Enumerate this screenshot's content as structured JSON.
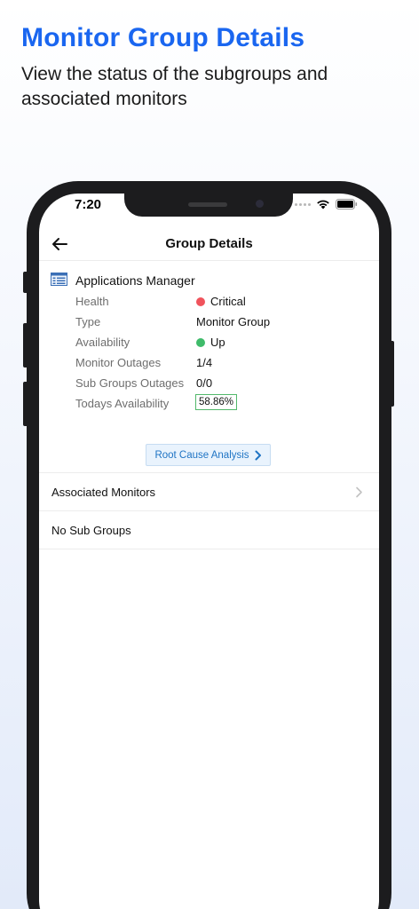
{
  "promo": {
    "title": "Monitor Group Details",
    "subtitle": "View the status of the subgroups and associated monitors"
  },
  "status_bar": {
    "time": "7:20"
  },
  "nav": {
    "title": "Group Details",
    "back_icon": "arrow-left-icon"
  },
  "group": {
    "name": "Applications Manager",
    "icon": "table-list-icon",
    "rows": [
      {
        "label": "Health",
        "value": "Critical",
        "status_color": "#f0535c"
      },
      {
        "label": "Type",
        "value": "Monitor Group"
      },
      {
        "label": "Availability",
        "value": "Up",
        "status_color": "#3fbb6a"
      },
      {
        "label": "Monitor Outages",
        "value": "1/4"
      },
      {
        "label": "Sub Groups Outages",
        "value": "0/0"
      },
      {
        "label": "Todays Availability",
        "value": "58.86%",
        "badge_color": "#52b86b"
      }
    ],
    "rca_button": "Root Cause Analysis"
  },
  "list": [
    {
      "label": "Associated Monitors",
      "has_chevron": true
    },
    {
      "label": "No Sub Groups",
      "has_chevron": false
    }
  ],
  "colors": {
    "brand_blue": "#1a66f0",
    "link_blue": "#1f74c4",
    "critical": "#f0535c",
    "up": "#3fbb6a"
  }
}
